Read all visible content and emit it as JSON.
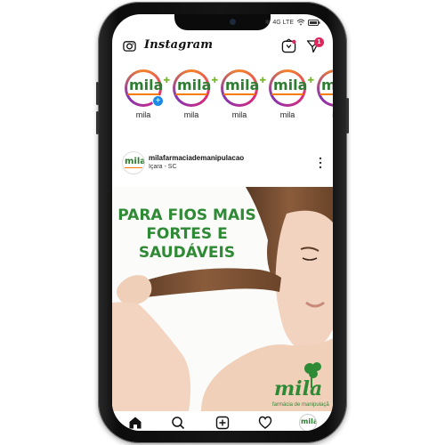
{
  "app": {
    "name": "Instagram"
  },
  "status_bar": {
    "bluetooth": "✱",
    "network": "4G LTE",
    "wifi": "wifi",
    "battery": "battery"
  },
  "header": {
    "dm_badge_count": "1",
    "icons": [
      "camera-icon",
      "igtv-icon",
      "direct-message-icon"
    ]
  },
  "stories": [
    {
      "label": "mila",
      "logo": "mila",
      "is_own": true
    },
    {
      "label": "mila",
      "logo": "mila",
      "is_own": false
    },
    {
      "label": "mila",
      "logo": "mila",
      "is_own": false
    },
    {
      "label": "mila",
      "logo": "mila",
      "is_own": false
    },
    {
      "label": "m",
      "logo": "mila",
      "is_own": false
    }
  ],
  "post": {
    "username": "milafarmaciademanipulacao",
    "location": "Içara - SC",
    "headline": [
      "PARA FIOS MAIS",
      "FORTES E",
      "SAUDÁVEIS"
    ],
    "watermark": {
      "brand": "mila",
      "tagline": "farmácia de manipulação"
    },
    "colors": {
      "headline": "#2f8a35",
      "accent": "#76b72a",
      "brand_orange": "#f57c00"
    }
  },
  "bottom_nav": [
    {
      "name": "home",
      "icon": "home-icon",
      "active": true
    },
    {
      "name": "search",
      "icon": "search-icon",
      "active": false
    },
    {
      "name": "new-post",
      "icon": "add-post-icon",
      "active": false
    },
    {
      "name": "activity",
      "icon": "heart-icon",
      "active": false
    },
    {
      "name": "profile",
      "icon": "profile-avatar",
      "active": false
    }
  ]
}
